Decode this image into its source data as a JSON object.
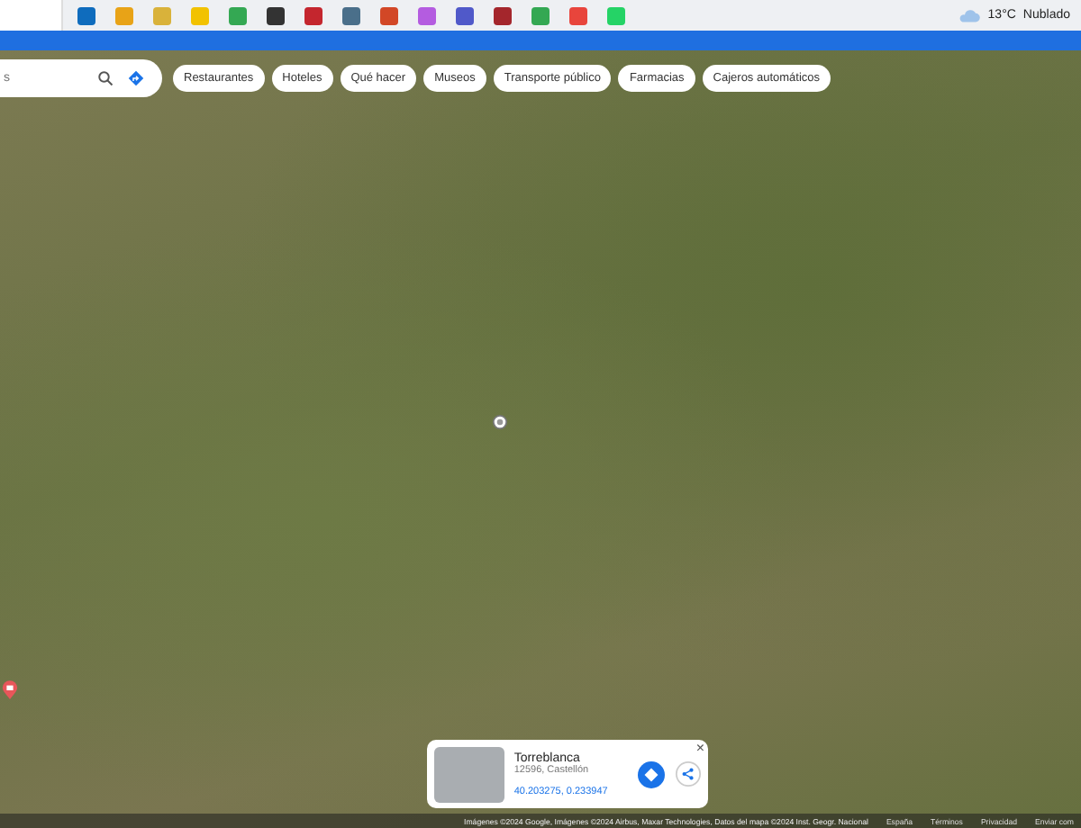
{
  "taskbar": {
    "apps": [
      {
        "color": "#0f6cbd"
      },
      {
        "color": "#e8a317"
      },
      {
        "color": "#d9b23a"
      },
      {
        "color": "#f2c200"
      },
      {
        "color": "#34a853"
      },
      {
        "color": "#333333"
      },
      {
        "color": "#c4262e"
      },
      {
        "color": "#4a6f8a"
      },
      {
        "color": "#d24726"
      },
      {
        "color": "#b45ce0"
      },
      {
        "color": "#5059c9"
      },
      {
        "color": "#a4262c"
      },
      {
        "color": "#34a853"
      },
      {
        "color": "#e8453c"
      },
      {
        "color": "#25d366"
      }
    ],
    "weather": {
      "temperature": "13°C",
      "condition": "Nublado"
    }
  },
  "search": {
    "placeholder": "s"
  },
  "chips": [
    {
      "label": "Restaurantes"
    },
    {
      "label": "Hoteles"
    },
    {
      "label": "Qué hacer"
    },
    {
      "label": "Museos"
    },
    {
      "label": "Transporte público"
    },
    {
      "label": "Farmacias"
    },
    {
      "label": "Cajeros automáticos"
    }
  ],
  "place_card": {
    "title": "Torreblanca",
    "subtitle": "12596, Castellón",
    "coordinates": "40.203275, 0.233947",
    "close": "×"
  },
  "footer": {
    "attribution": "Imágenes ©2024 Google, Imágenes ©2024 Airbus, Maxar Technologies, Datos del mapa ©2024 Inst. Geogr. Nacional",
    "links": [
      "España",
      "Términos",
      "Privacidad",
      "Enviar com"
    ]
  }
}
